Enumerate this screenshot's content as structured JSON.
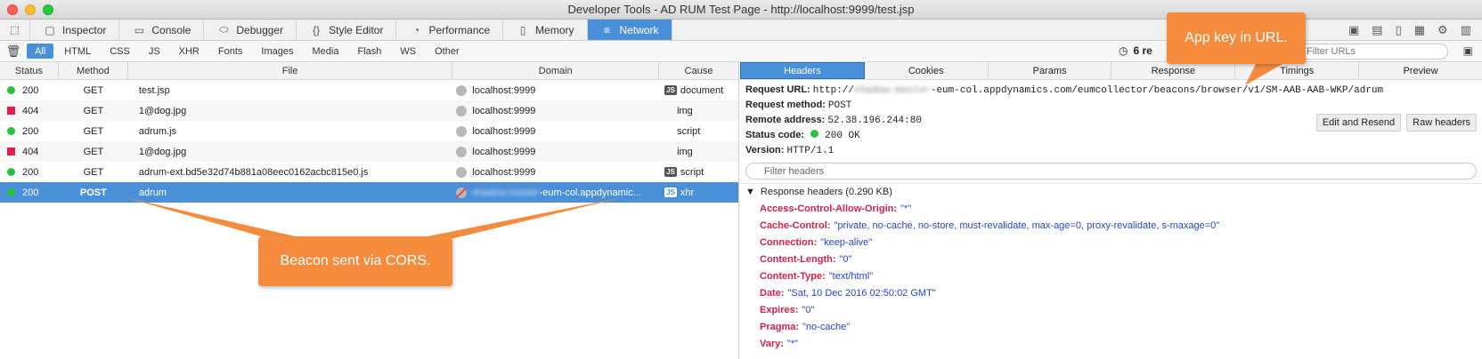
{
  "window": {
    "title": "Developer Tools - AD RUM Test Page - http://localhost:9999/test.jsp"
  },
  "tabs": [
    {
      "label": "Inspector",
      "icon": "inspector-icon"
    },
    {
      "label": "Console",
      "icon": "console-icon"
    },
    {
      "label": "Debugger",
      "icon": "debugger-icon"
    },
    {
      "label": "Style Editor",
      "icon": "style-editor-icon"
    },
    {
      "label": "Performance",
      "icon": "performance-icon"
    },
    {
      "label": "Memory",
      "icon": "memory-icon"
    },
    {
      "label": "Network",
      "icon": "network-icon"
    }
  ],
  "filters": [
    "All",
    "HTML",
    "CSS",
    "JS",
    "XHR",
    "Fonts",
    "Images",
    "Media",
    "Flash",
    "WS",
    "Other"
  ],
  "toolbar": {
    "summary": "6 re",
    "filter_placeholder": "Filter URLs"
  },
  "table": {
    "headers": {
      "status": "Status",
      "method": "Method",
      "file": "File",
      "domain": "Domain",
      "cause": "Cause"
    },
    "rows": [
      {
        "status": "200",
        "method": "GET",
        "file": "test.jsp",
        "domain": "localhost:9999",
        "cause": "document",
        "js": true
      },
      {
        "status": "404",
        "method": "GET",
        "file": "1@dog.jpg",
        "domain": "localhost:9999",
        "cause": "img",
        "js": false
      },
      {
        "status": "200",
        "method": "GET",
        "file": "adrum.js",
        "domain": "localhost:9999",
        "cause": "script",
        "js": false
      },
      {
        "status": "404",
        "method": "GET",
        "file": "1@dog.jpg",
        "domain": "localhost:9999",
        "cause": "img",
        "js": false
      },
      {
        "status": "200",
        "method": "GET",
        "file": "adrum-ext.bd5e32d74b881a08eec0162acbc815e0.js",
        "domain": "localhost:9999",
        "cause": "script",
        "js": true
      },
      {
        "status": "200",
        "method": "POST",
        "file": "adrum",
        "domain_blur": "shadow-master",
        "domain": "-eum-col.appdynamic...",
        "cause": "xhr",
        "js": true
      }
    ]
  },
  "details": {
    "tabs": [
      "Headers",
      "Cookies",
      "Params",
      "Response",
      "Timings",
      "Preview"
    ],
    "request_url_label": "Request URL:",
    "request_url_prefix": "http://",
    "request_url_blur": "shadow-master",
    "request_url_rest": "-eum-col.appdynamics.com/eumcollector/beacons/browser/v1/SM-AAB-AAB-WKP/adrum",
    "request_method_label": "Request method:",
    "request_method": "POST",
    "remote_address_label": "Remote address:",
    "remote_address": "52.38.196.244:80",
    "status_code_label": "Status code:",
    "status_code": "200 OK",
    "version_label": "Version:",
    "version": "HTTP/1.1",
    "edit_resend": "Edit and Resend",
    "raw_headers": "Raw headers",
    "filter_headers_placeholder": "Filter headers",
    "response_section": "Response headers (0.290 KB)",
    "headers": [
      {
        "k": "Access-Control-Allow-Origin:",
        "v": "\"*\""
      },
      {
        "k": "Cache-Control:",
        "v": "\"private, no-cache, no-store, must-revalidate, max-age=0, proxy-revalidate, s-maxage=0\""
      },
      {
        "k": "Connection:",
        "v": "\"keep-alive\""
      },
      {
        "k": "Content-Length:",
        "v": "\"0\""
      },
      {
        "k": "Content-Type:",
        "v": "\"text/html\""
      },
      {
        "k": "Date:",
        "v": "\"Sat, 10 Dec 2016 02:50:02 GMT\""
      },
      {
        "k": "Expires:",
        "v": "\"0\""
      },
      {
        "k": "Pragma:",
        "v": "\"no-cache\""
      },
      {
        "k": "Vary:",
        "v": "\"*\""
      }
    ]
  },
  "callouts": {
    "cors": "Beacon sent via CORS.",
    "appkey": "App key in URL."
  }
}
